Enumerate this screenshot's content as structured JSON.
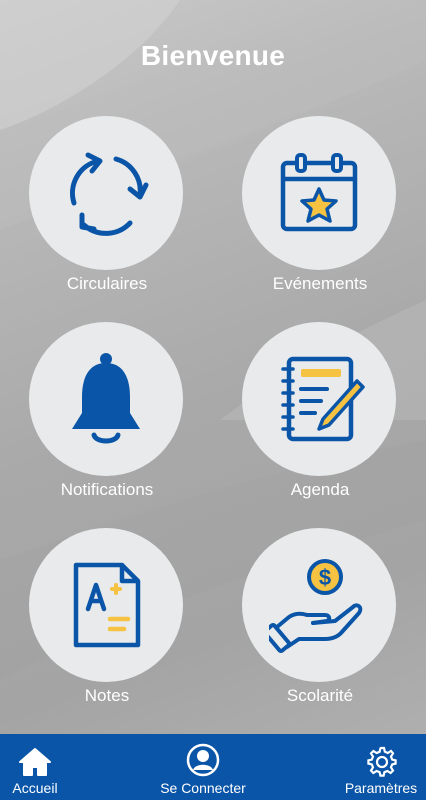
{
  "header": {
    "title": "Bienvenue"
  },
  "tiles": [
    {
      "label": "Circulaires",
      "icon": "refresh-cycle-icon"
    },
    {
      "label": "Evénements",
      "icon": "calendar-star-icon"
    },
    {
      "label": "Notifications",
      "icon": "bell-icon"
    },
    {
      "label": "Agenda",
      "icon": "notebook-pencil-icon"
    },
    {
      "label": "Notes",
      "icon": "grade-document-icon"
    },
    {
      "label": "Scolarité",
      "icon": "hand-coin-icon"
    }
  ],
  "bottom_nav": {
    "home_label": "Accueil",
    "login_label": "Se Connecter",
    "settings_label": "Paramètres"
  },
  "colors": {
    "primary_blue": "#0a55a7",
    "accent_yellow": "#f5c242",
    "circle_bg": "#e8eaeb"
  }
}
